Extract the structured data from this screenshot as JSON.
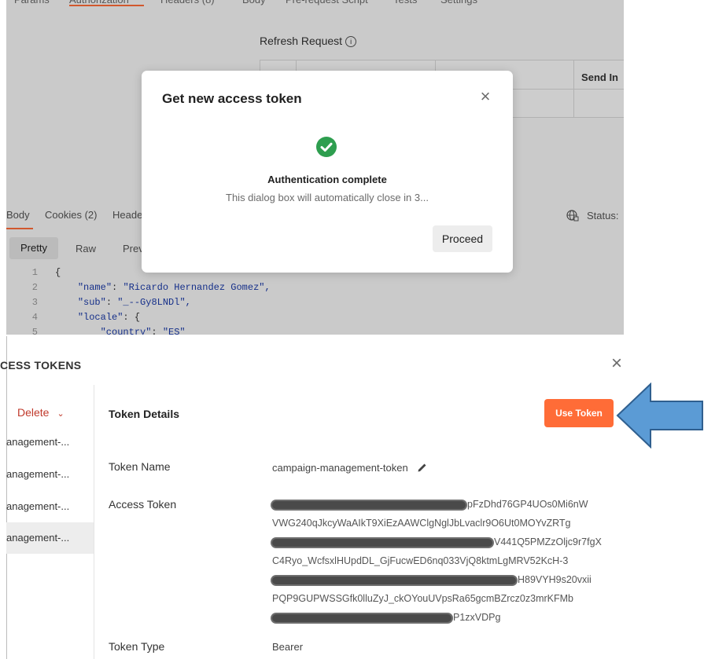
{
  "postman_background": {
    "refresh_request_label": "Refresh Request",
    "refresh_info_glyph": "i",
    "send_in_header": "Send In",
    "response_tabs": [
      "Body",
      "Cookies (2)",
      "Heade"
    ],
    "status_label": "Status:",
    "format_buttons": [
      "Pretty",
      "Raw",
      "Prev"
    ],
    "code_lines": [
      {
        "num": "1",
        "text": "{"
      },
      {
        "num": "2",
        "key": "\"name\"",
        "value": "\"Ricardo Hernandez Gomez\","
      },
      {
        "num": "3",
        "key": "\"sub\"",
        "value": "\"_--Gy8LNDl\","
      },
      {
        "num": "4",
        "key": "\"locale\"",
        "value": "{"
      },
      {
        "num": "5",
        "key": "\"country\"",
        "value": "\"ES\""
      }
    ]
  },
  "modal": {
    "title": "Get new access token",
    "close_glyph": "×",
    "status_title": "Authentication complete",
    "status_message": "This dialog box will automatically close in 3...",
    "proceed_label": "Proceed",
    "success_color": "#2e9e4f"
  },
  "manage_tokens": {
    "title": "CESS TOKENS",
    "close_glyph": "×",
    "delete_label": "Delete",
    "sidebar_items": [
      "anagement-...",
      "anagement-...",
      "anagement-...",
      "anagement-..."
    ],
    "details_title": "Token Details",
    "use_token_label": "Use Token",
    "token_name_label": "Token Name",
    "token_name_value": "campaign-management-token",
    "access_token_label": "Access Token",
    "access_token_lines": [
      "pFzDhd76GP4UOs0Mi6nW",
      "VWG240qJkcyWaAIkT9XiEzAAWClgNglJbLvaclr9O6Ut0MOYvZRTg",
      "V441Q5PMZzOljc9r7fgX",
      "C4Ryo_WcfsxlHUpdDL_GjFucwED6nq033VjQ8ktmLgMRV52KcH-3",
      "H89VYH9s20vxii",
      "PQP9GUPWSSGfk0lluZyJ_ckOYouUVpsRa65gcmBZrcz0z3mrKFMb",
      "P1zxVDPg"
    ],
    "token_type_label": "Token Type",
    "token_type_value": "Bearer",
    "accent_color": "#ff6c37"
  },
  "annotation_arrow_color": "#5b9bd5"
}
